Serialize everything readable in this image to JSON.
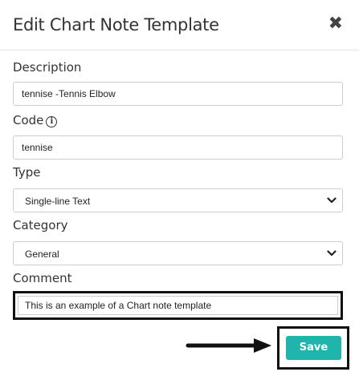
{
  "dialog": {
    "title": "Edit Chart Note Template",
    "close_label": "✖"
  },
  "fields": {
    "description": {
      "label": "Description",
      "value": "tennise -Tennis Elbow"
    },
    "code": {
      "label": "Code",
      "info_icon": "info-icon",
      "value": "tennise"
    },
    "type": {
      "label": "Type",
      "selected": "Single-line Text"
    },
    "category": {
      "label": "Category",
      "selected": "General"
    },
    "comment": {
      "label": "Comment",
      "value": "This is an example of a Chart note template"
    }
  },
  "actions": {
    "save_label": "Save"
  },
  "colors": {
    "accent": "#1fb5ac",
    "highlight_border": "#111111"
  }
}
